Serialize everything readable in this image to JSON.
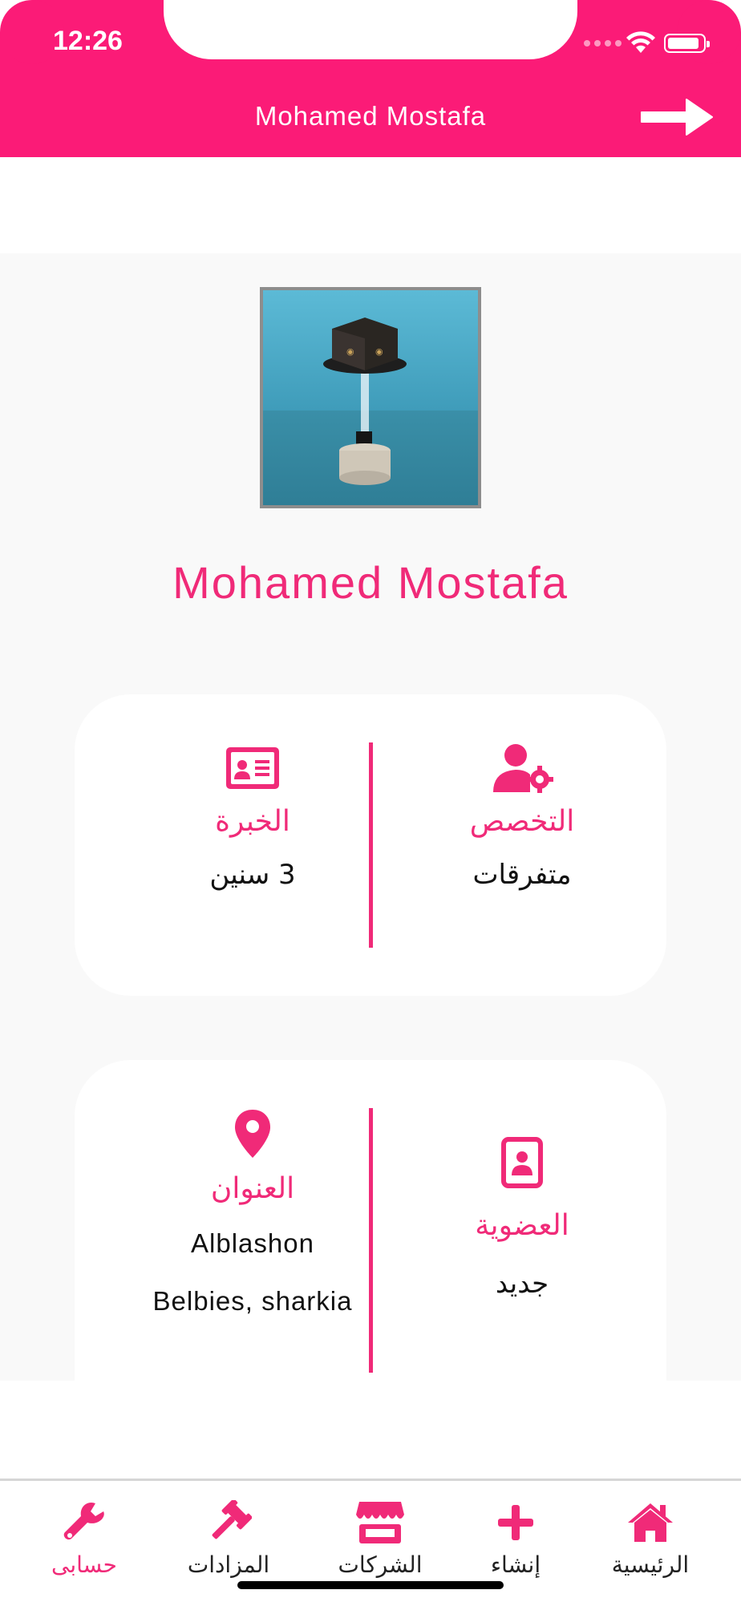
{
  "status_bar": {
    "time": "12:26"
  },
  "header": {
    "title": "Mohamed Mostafa",
    "back_icon": "arrow-right-icon"
  },
  "profile": {
    "name": "Mohamed Mostafa",
    "image": "profile-photo-product-stand"
  },
  "colors": {
    "primary": "#fb1b77",
    "accent_text": "#f02a78",
    "background": "#f9f9f9",
    "card": "#ffffff"
  },
  "card1": {
    "specialty": {
      "icon": "user-gear-icon",
      "label": "التخصص",
      "value": "متفرقات"
    },
    "experience": {
      "icon": "id-card-icon",
      "label": "الخبرة",
      "value": "3 سنين"
    }
  },
  "card2": {
    "membership": {
      "icon": "contact-badge-icon",
      "label": "العضوية",
      "value": "جديد"
    },
    "address": {
      "icon": "map-pin-icon",
      "label": "العنوان",
      "line1": "Alblashon",
      "line2": "Belbies, sharkia"
    }
  },
  "tabbar": {
    "items": [
      {
        "label": "حسابى",
        "icon": "wrench-icon",
        "active": true
      },
      {
        "label": "المزادات",
        "icon": "gavel-icon",
        "active": false
      },
      {
        "label": "الشركات",
        "icon": "store-icon",
        "active": false
      },
      {
        "label": "إنشاء",
        "icon": "plus-icon",
        "active": false
      },
      {
        "label": "الرئيسية",
        "icon": "home-icon",
        "active": false
      }
    ]
  }
}
